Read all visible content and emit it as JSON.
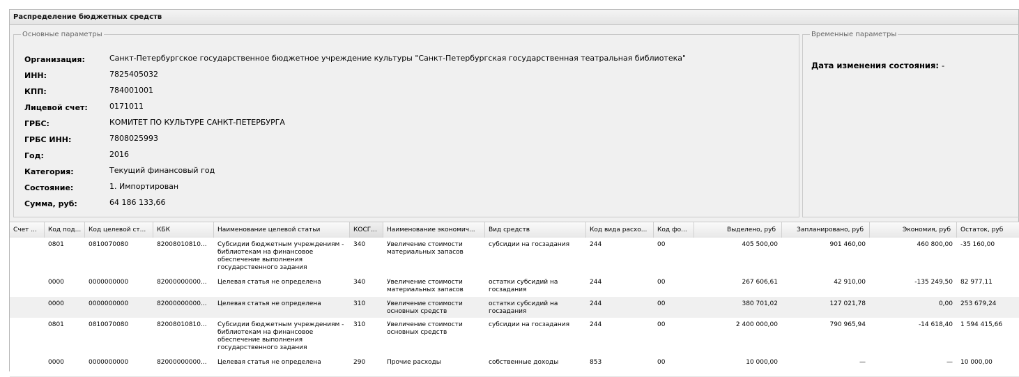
{
  "panel": {
    "title": "Распределение бюджетных средств"
  },
  "main_params": {
    "legend": "Основные параметры",
    "fields": [
      {
        "label": "Организация:",
        "value": "Санкт-Петербургское государственное бюджетное учреждение культуры \"Санкт-Петербургская государственная театральная библиотека\""
      },
      {
        "label": "ИНН:",
        "value": "7825405032"
      },
      {
        "label": "КПП:",
        "value": "784001001"
      },
      {
        "label": "Лицевой счет:",
        "value": "0171011"
      },
      {
        "label": "ГРБС:",
        "value": "КОМИТЕТ ПО КУЛЬТУРЕ САНКТ-ПЕТЕРБУРГА"
      },
      {
        "label": "ГРБС ИНН:",
        "value": "7808025993"
      },
      {
        "label": "Год:",
        "value": "2016"
      },
      {
        "label": "Категория:",
        "value": "Текущий финансовый год"
      },
      {
        "label": "Состояние:",
        "value": "1. Импортирован"
      },
      {
        "label": "Сумма, руб:",
        "value": "64 186 133,66"
      }
    ]
  },
  "temp_params": {
    "legend": "Временные параметры",
    "label": "Дата изменения состояния:",
    "value": "-"
  },
  "grid": {
    "columns": [
      "Счет ...",
      "Код под...",
      "Код целевой ст...",
      "КБК",
      "Наименование целевой статьи",
      "КОСГ...",
      "Наименование экономич...",
      "Вид средств",
      "Код вида расхо...",
      "Код фо...",
      "Выделено, руб",
      "Запланировано, руб",
      "Экономия, руб",
      "Остаток, руб"
    ],
    "rows": [
      {
        "acc": "",
        "pod": "0801",
        "cs": "0810070080",
        "kbk": "82008010810...",
        "cs_name": "Субсидии бюджетным учреждениям -\nбиблиотекам на финансовое\nобеспечение выполнения\nгосударственного задания",
        "kosgu": "340",
        "econ": "Увеличение стоимости\nматериальных запасов",
        "vid": "субсидии на госзадания",
        "kvr": "244",
        "kfo": "00",
        "alloc": "405 500,00",
        "plan": "901 460,00",
        "econ_sum": "460 800,00",
        "rest": "-35 160,00"
      },
      {
        "acc": "",
        "pod": "0000",
        "cs": "0000000000",
        "kbk": "82000000000...",
        "cs_name": "Целевая статья не определена",
        "kosgu": "340",
        "econ": "Увеличение стоимости\nматериальных запасов",
        "vid": "остатки субсидий на\nгосзадания",
        "kvr": "244",
        "kfo": "00",
        "alloc": "267 606,61",
        "plan": "42 910,00",
        "econ_sum": "-135 249,50",
        "rest": "82 977,11"
      },
      {
        "acc": "",
        "pod": "0000",
        "cs": "0000000000",
        "kbk": "82000000000...",
        "cs_name": "Целевая статья не определена",
        "kosgu": "310",
        "econ": "Увеличение стоимости\nосновных средств",
        "vid": "остатки субсидий на\nгосзадания",
        "kvr": "244",
        "kfo": "00",
        "alloc": "380 701,02",
        "plan": "127 021,78",
        "econ_sum": "0,00",
        "rest": "253 679,24"
      },
      {
        "acc": "",
        "pod": "0801",
        "cs": "0810070080",
        "kbk": "82008010810...",
        "cs_name": "Субсидии бюджетным учреждениям -\nбиблиотекам на финансовое\nобеспечение выполнения\nгосударственного задания",
        "kosgu": "310",
        "econ": "Увеличение стоимости\nосновных средств",
        "vid": "субсидии на госзадания",
        "kvr": "244",
        "kfo": "00",
        "alloc": "2 400 000,00",
        "plan": "790 965,94",
        "econ_sum": "-14 618,40",
        "rest": "1 594 415,66"
      },
      {
        "acc": "",
        "pod": "0000",
        "cs": "0000000000",
        "kbk": "82000000000...",
        "cs_name": "Целевая статья не определена",
        "kosgu": "290",
        "econ": "Прочие расходы",
        "vid": "собственные доходы",
        "kvr": "853",
        "kfo": "00",
        "alloc": "10 000,00",
        "plan": "—",
        "econ_sum": "—",
        "rest": "10 000,00"
      }
    ]
  }
}
